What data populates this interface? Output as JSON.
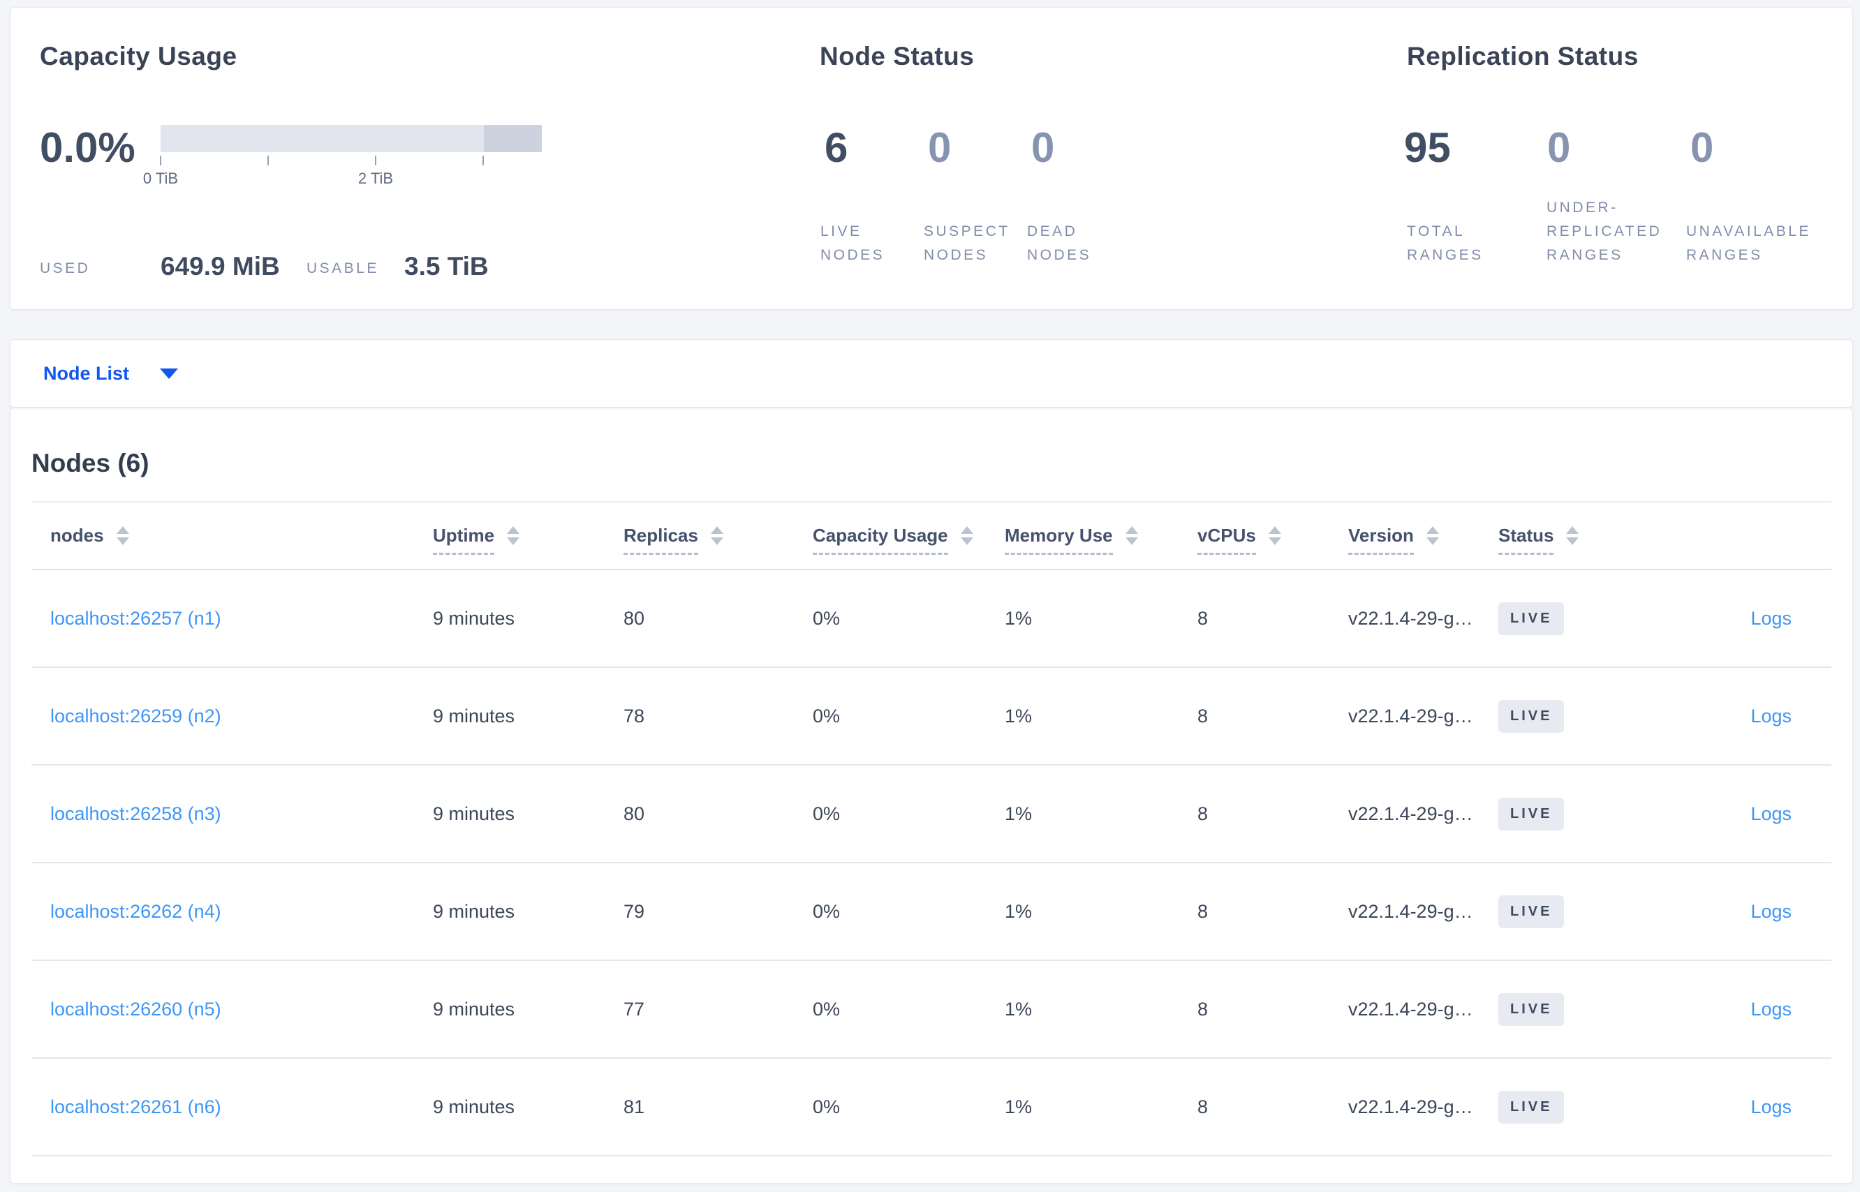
{
  "colors": {
    "accent_blue": "#1257f0",
    "link_blue": "#3e96f6",
    "badge_bg": "#e7eaf0",
    "badge_text": "#3e4a61",
    "bar_light_segment": "#e3e5ee",
    "bar_dark_segment": "#ced2de",
    "dark_text": "#3a4456",
    "muted_label": "#818da9"
  },
  "summary": {
    "capacity": {
      "title": "Capacity Usage",
      "percent": "0.0%",
      "used_label": "USED",
      "used_value": "649.9 MiB",
      "usable_label": "USABLE",
      "usable_value": "3.5 TiB",
      "bar": {
        "type": "bar",
        "used_fraction": 0.0,
        "max_tib": 3.5,
        "ticks_tib": [
          0,
          1,
          2,
          3
        ],
        "tick_labels": [
          "0 TiB",
          "2 TiB"
        ],
        "segments": [
          {
            "name": "usable",
            "from_tib": 0,
            "to_tib": 3.0,
            "color": "#e3e5ee"
          },
          {
            "name": "other",
            "from_tib": 3.0,
            "to_tib": 3.5,
            "color": "#ced2de"
          }
        ]
      }
    },
    "node_status": {
      "title": "Node Status",
      "metrics": [
        {
          "value": "6",
          "label": "LIVE NODES",
          "emphasis": true
        },
        {
          "value": "0",
          "label": "SUSPECT NODES",
          "emphasis": false
        },
        {
          "value": "0",
          "label": "DEAD NODES",
          "emphasis": false
        }
      ]
    },
    "replication": {
      "title": "Replication Status",
      "metrics": [
        {
          "value": "95",
          "label": "TOTAL RANGES",
          "emphasis": true
        },
        {
          "value": "0",
          "label": "UNDER-REPLICATED RANGES",
          "emphasis": false
        },
        {
          "value": "0",
          "label": "UNAVAILABLE RANGES",
          "emphasis": false
        }
      ]
    }
  },
  "view_selector": {
    "label": "Node List"
  },
  "nodes_section": {
    "title": "Nodes (6)",
    "columns": [
      {
        "label": "nodes"
      },
      {
        "label": "Uptime"
      },
      {
        "label": "Replicas"
      },
      {
        "label": "Capacity Usage"
      },
      {
        "label": "Memory Use"
      },
      {
        "label": "vCPUs"
      },
      {
        "label": "Version"
      },
      {
        "label": "Status"
      }
    ],
    "rows": [
      {
        "address": "localhost:26257 (n1)",
        "uptime": "9 minutes",
        "replicas": "80",
        "capacity": "0%",
        "memory": "1%",
        "vcpus": "8",
        "version": "v22.1.4-29-g…",
        "status": "LIVE",
        "logs": "Logs"
      },
      {
        "address": "localhost:26259 (n2)",
        "uptime": "9 minutes",
        "replicas": "78",
        "capacity": "0%",
        "memory": "1%",
        "vcpus": "8",
        "version": "v22.1.4-29-g…",
        "status": "LIVE",
        "logs": "Logs"
      },
      {
        "address": "localhost:26258 (n3)",
        "uptime": "9 minutes",
        "replicas": "80",
        "capacity": "0%",
        "memory": "1%",
        "vcpus": "8",
        "version": "v22.1.4-29-g…",
        "status": "LIVE",
        "logs": "Logs"
      },
      {
        "address": "localhost:26262 (n4)",
        "uptime": "9 minutes",
        "replicas": "79",
        "capacity": "0%",
        "memory": "1%",
        "vcpus": "8",
        "version": "v22.1.4-29-g…",
        "status": "LIVE",
        "logs": "Logs"
      },
      {
        "address": "localhost:26260 (n5)",
        "uptime": "9 minutes",
        "replicas": "77",
        "capacity": "0%",
        "memory": "1%",
        "vcpus": "8",
        "version": "v22.1.4-29-g…",
        "status": "LIVE",
        "logs": "Logs"
      },
      {
        "address": "localhost:26261 (n6)",
        "uptime": "9 minutes",
        "replicas": "81",
        "capacity": "0%",
        "memory": "1%",
        "vcpus": "8",
        "version": "v22.1.4-29-g…",
        "status": "LIVE",
        "logs": "Logs"
      }
    ]
  }
}
